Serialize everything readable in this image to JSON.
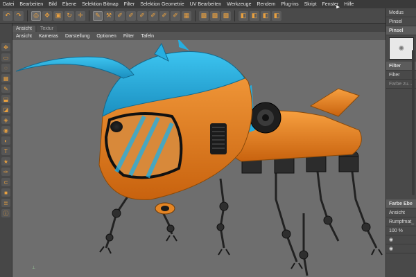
{
  "menu": [
    "Datei",
    "Bearbeiten",
    "Bild",
    "Ebene",
    "Selektion Bitmap",
    "Filter",
    "Selektion Geometrie",
    "UV Bearbeiten",
    "Werkzeuge",
    "Rendern",
    "Plug-ins",
    "Skript",
    "Fenster",
    "Hilfe"
  ],
  "tabs": {
    "ansicht": "Ansicht",
    "textur": "Textur"
  },
  "view_menu": [
    "Ansicht",
    "Kameras",
    "Darstellung",
    "Optionen",
    "Filter",
    "Tafeln"
  ],
  "right_panel": {
    "modus": "Modus",
    "pinsel_tool": "Pinsel",
    "pinsel_header": "Pinsel",
    "filter_header": "Filter",
    "filter_item": "Filter",
    "farbe_item": "Farbe zu...",
    "tab_farbe": "Farbe",
    "tab_ebene": "Ebe",
    "ansicht": "Ansicht",
    "layer_name": "Rumpfmat_",
    "percent": "100 %"
  },
  "colors": {
    "orange": "#f28a1e",
    "cyan": "#27aee0",
    "viewport": "#6e6e6e"
  }
}
